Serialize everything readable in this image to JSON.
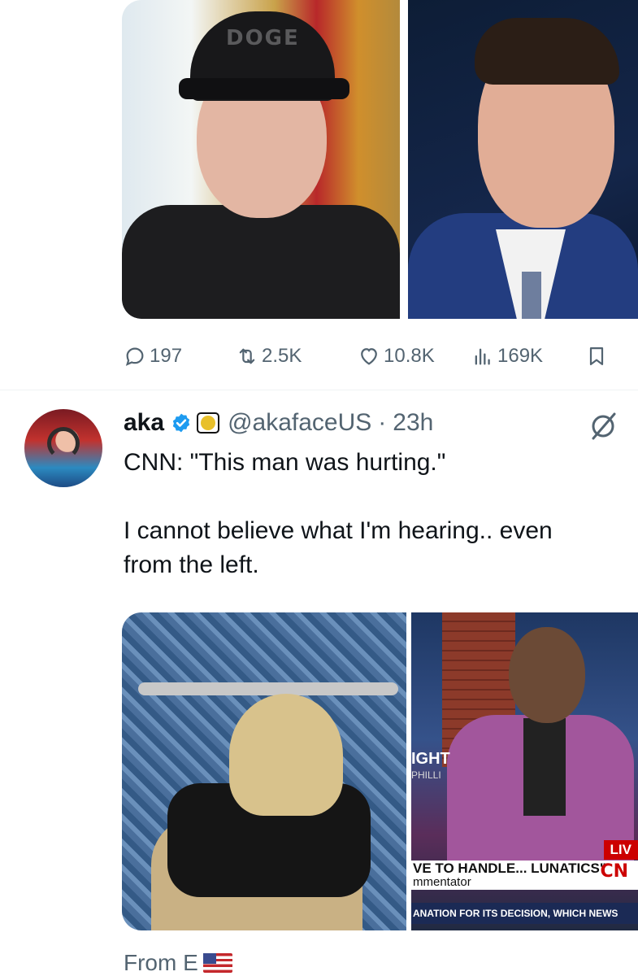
{
  "tweet1": {
    "media": {
      "photo_left_cap_text": "DOGE"
    },
    "actions": {
      "replies": "197",
      "reposts": "2.5K",
      "likes": "10.8K",
      "views": "169K"
    }
  },
  "tweet2": {
    "author": {
      "name": "aka",
      "handle": "@akafaceUS",
      "separator": "·",
      "time": "23h"
    },
    "text": {
      "line1": "CNN: \"This man was hurting.\"",
      "line2": "I cannot believe what I'm hearing.. even",
      "line3": "from the left."
    },
    "media": {
      "ght_label": "IGHT",
      "ght_sub": "PHILLI",
      "live_label": "LIV",
      "chyron_main": "VE TO HANDLE... LUNATICS\"",
      "chyron_sub": "mmentator",
      "cnn_logo": "CN",
      "ticker": "ANATION FOR ITS DECISION, WHICH NEWS"
    },
    "footer": {
      "from_text": "From E"
    }
  },
  "colors": {
    "muted": "#536471",
    "text": "#0f1419",
    "verified_blue": "#1d9bf0",
    "divider": "#eff3f4"
  }
}
